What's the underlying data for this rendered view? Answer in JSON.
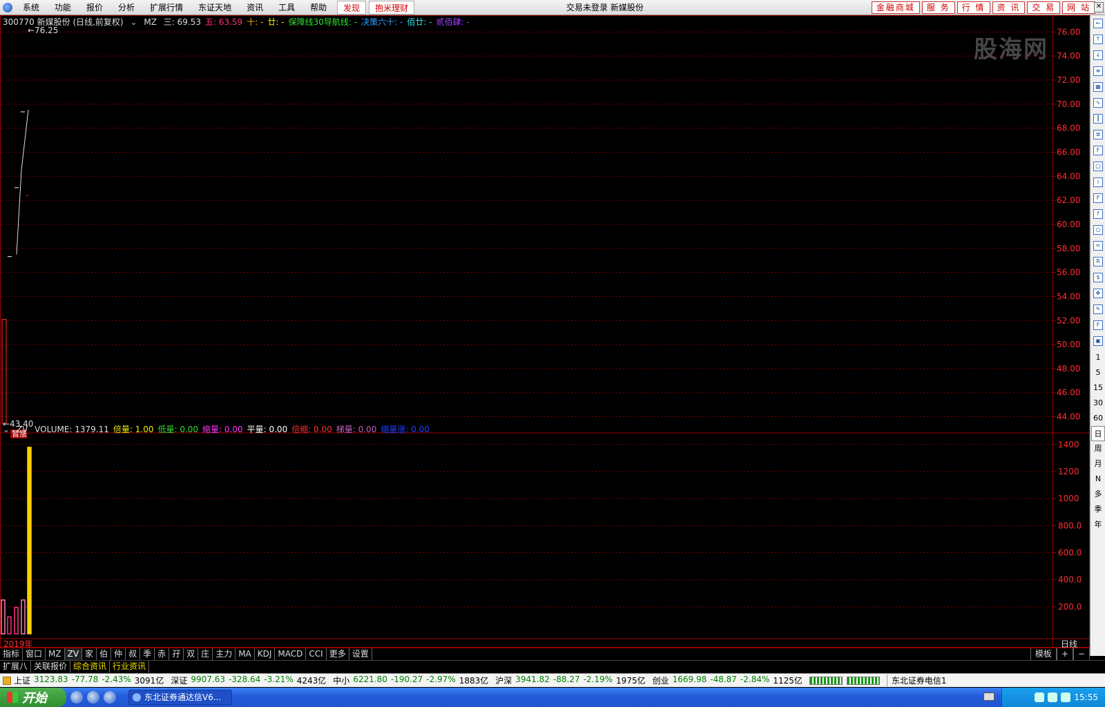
{
  "menu": {
    "items": [
      "系统",
      "功能",
      "报价",
      "分析",
      "扩展行情",
      "东证天地",
      "资讯",
      "工具",
      "帮助"
    ],
    "highlight": [
      "发现",
      "抱米理财"
    ],
    "center_title": "交易未登录  新媒股份",
    "right_buttons": [
      "金融商城",
      "服 务",
      "行 情",
      "资 讯",
      "交 易",
      "网 站"
    ]
  },
  "watermark": "股海网",
  "price_info": {
    "code_name": "300770 新媒股份 (日线,前复权)",
    "indicator": "MZ",
    "items": [
      {
        "label": "三: 69.53",
        "color": "#dddddd"
      },
      {
        "label": "五: 63.59",
        "color": "#ff3080"
      },
      {
        "label": "十: -",
        "color": "#ffb000"
      },
      {
        "label": "廿: -",
        "color": "#f0f000"
      },
      {
        "label": "保障线30导航线: -",
        "color": "#30e030"
      },
      {
        "label": "决策六十: -",
        "color": "#30a0ff"
      },
      {
        "label": "佰廿: -",
        "color": "#30e0e0"
      },
      {
        "label": "贰佰肆: -",
        "color": "#a040ff"
      }
    ]
  },
  "volume_info": {
    "indicator": "ZV",
    "items": [
      {
        "label": "VOLUME: 1379.11",
        "color": "#dddddd"
      },
      {
        "label": "倍量: 1.00",
        "color": "#f0f000"
      },
      {
        "label": "低量: 0.00",
        "color": "#30e030"
      },
      {
        "label": "缩量: 0.00",
        "color": "#ff30ff"
      },
      {
        "label": "平量: 0.00",
        "color": "#ffffff"
      },
      {
        "label": "倍缩: 0.00",
        "color": "#ff3030"
      },
      {
        "label": "梯量: 0.00",
        "color": "#c060c0"
      },
      {
        "label": "缩量涨: 0.00",
        "color": "#2040ff"
      }
    ]
  },
  "chart_data": [
    {
      "type": "line",
      "title": "300770 新媒股份 (日线,前复权)",
      "ylim": [
        43.4,
        76.25
      ],
      "yticks": [
        76.0,
        74.0,
        72.0,
        70.0,
        68.0,
        66.0,
        64.0,
        62.0,
        60.0,
        58.0,
        56.0,
        54.0,
        52.0,
        50.0,
        48.0,
        46.0,
        44.0
      ],
      "ytick_labels": [
        "76.00",
        "74.00",
        "72.00",
        "70.00",
        "68.00",
        "66.00",
        "64.00",
        "62.00",
        "60.00",
        "58.00",
        "56.00",
        "54.00",
        "52.00",
        "50.00",
        "48.00",
        "46.00",
        "44.00"
      ],
      "annotations": {
        "max": "76.25",
        "min": "43.40",
        "tag": "暂涨"
      },
      "series": [
        {
          "name": "三",
          "values": [
            57.5,
            64.5,
            69.53
          ]
        }
      ],
      "candles": [
        {
          "open": 43.4,
          "close": 52.1,
          "high": 52.1,
          "low": 43.4,
          "color": "#ff3030"
        },
        {
          "open": 57.32,
          "close": 57.32,
          "high": 57.32,
          "low": 57.32,
          "color": "#ffffff"
        },
        {
          "open": 63.05,
          "close": 63.05,
          "high": 63.05,
          "low": 63.05,
          "color": "#ffffff"
        },
        {
          "open": 69.36,
          "close": 69.36,
          "high": 69.36,
          "low": 69.36,
          "color": "#ffffff"
        }
      ],
      "grid": true
    },
    {
      "type": "bar",
      "title": "VOLUME",
      "ylim": [
        0,
        1450
      ],
      "yticks": [
        1400,
        1200,
        1000,
        800.0,
        600.0,
        400.0,
        200.0
      ],
      "ytick_labels": [
        "1400",
        "1200",
        "1000",
        "800.0",
        "600.0",
        "400.0",
        "200.0"
      ],
      "values": [
        250,
        125,
        195,
        250,
        1379.11
      ],
      "colors": [
        "#ff80b0",
        "#ff3080",
        "#ff3080",
        "#ff80b0",
        "#ffd000"
      ],
      "grid": true
    }
  ],
  "x_axis": {
    "year_label": "2019年",
    "period_label": "日线"
  },
  "right_toolbar": {
    "periods": [
      "1",
      "5",
      "15",
      "30",
      "60",
      "日",
      "周",
      "月",
      "N",
      "多",
      "季",
      "年"
    ]
  },
  "tabs1": {
    "items": [
      "指标",
      "窗口",
      "MZ",
      "ZV",
      "家",
      "伯",
      "仲",
      "叔",
      "季",
      "赤",
      "孖",
      "双",
      "庄",
      "主力",
      "MA",
      "KDJ",
      "MACD",
      "CCI",
      "更多",
      "设置"
    ],
    "right": [
      "模板",
      "+",
      "−"
    ]
  },
  "tabs2": {
    "items": [
      "扩展八",
      "关联报价",
      "综合资讯",
      "行业资讯"
    ]
  },
  "statusbar": {
    "indices": [
      {
        "name": "上证",
        "value": "3123.83",
        "change": "-77.78",
        "pct": "-2.43%",
        "amount": "3091亿"
      },
      {
        "name": "深证",
        "value": "9907.63",
        "change": "-328.64",
        "pct": "-3.21%",
        "amount": "4243亿"
      },
      {
        "name": "中小",
        "value": "6221.80",
        "change": "-190.27",
        "pct": "-2.97%",
        "amount": "1883亿"
      },
      {
        "name": "沪深",
        "value": "3941.82",
        "change": "-88.27",
        "pct": "-2.19%",
        "amount": "1975亿"
      },
      {
        "name": "创业",
        "value": "1669.98",
        "change": "-48.87",
        "pct": "-2.84%",
        "amount": "1125亿"
      }
    ],
    "broker": "东北证券电信1"
  },
  "taskbar": {
    "start": "开始",
    "app": "东北证券通达信V6...",
    "time": "15:55"
  }
}
